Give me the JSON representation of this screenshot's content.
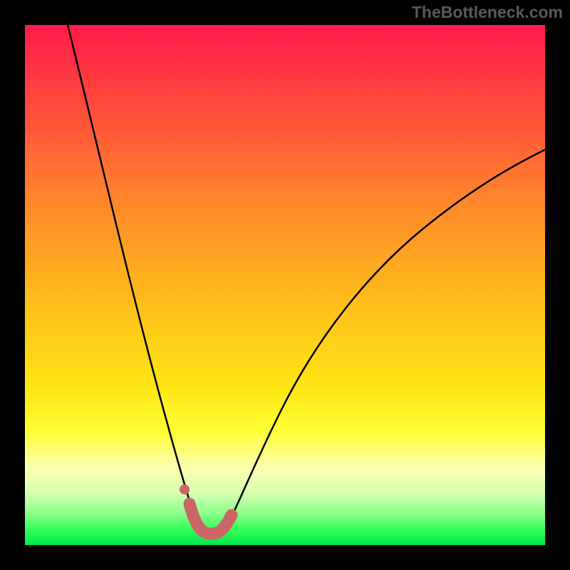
{
  "watermark": "TheBottleneck.com",
  "chart_data": {
    "type": "line",
    "title": "",
    "xlabel": "",
    "ylabel": "",
    "xlim": [
      0,
      100
    ],
    "ylim": [
      0,
      100
    ],
    "grid": false,
    "legend": false,
    "background": "vertical-gradient red-to-green",
    "series": [
      {
        "name": "curve",
        "color": "#000000",
        "x": [
          8,
          12,
          16,
          20,
          24,
          27,
          29,
          31,
          33,
          35,
          37,
          39,
          41,
          44,
          48,
          54,
          62,
          72,
          84,
          100
        ],
        "y": [
          100,
          85,
          70,
          55,
          40,
          28,
          20,
          12,
          6,
          2,
          2,
          4,
          8,
          14,
          24,
          36,
          50,
          62,
          72,
          80
        ]
      },
      {
        "name": "highlight-band",
        "color": "#cc6666",
        "x": [
          31,
          33,
          35,
          37,
          39
        ],
        "y": [
          5,
          2,
          2,
          2,
          5
        ]
      },
      {
        "name": "highlight-dot",
        "color": "#cc6666",
        "x": [
          30
        ],
        "y": [
          11
        ]
      }
    ],
    "annotations": []
  }
}
